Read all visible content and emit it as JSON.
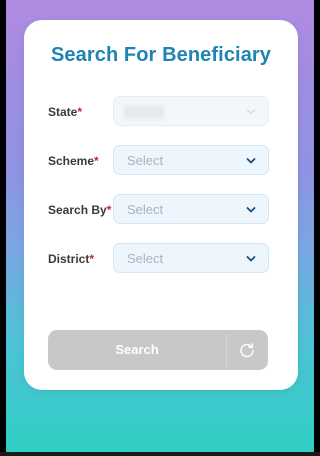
{
  "form": {
    "title": "Search For Beneficiary",
    "fields": [
      {
        "label": "State",
        "required_mark": "*",
        "value": "",
        "disabled": true
      },
      {
        "label": "Scheme",
        "required_mark": "*",
        "value": "Select"
      },
      {
        "label": "Search By",
        "required_mark": "*",
        "value": "Select"
      },
      {
        "label": "District",
        "required_mark": "*",
        "value": "Select"
      }
    ],
    "search_button": "Search"
  },
  "colors": {
    "title": "#1f84b4",
    "required": "#c62828",
    "button_disabled": "#c8c8c8"
  },
  "icons": {
    "dropdown": "chevron-down-icon",
    "refresh": "refresh-icon"
  }
}
